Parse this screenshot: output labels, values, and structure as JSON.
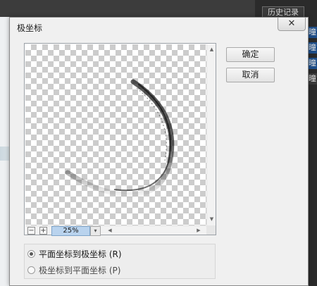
{
  "background": {
    "history_panel_tab": "历史记录",
    "panel_strip_chars": [
      "曈",
      "曈",
      "曈",
      "曈"
    ]
  },
  "dialog": {
    "title": "极坐标",
    "close_symbol": "✕",
    "buttons": {
      "ok": "确定",
      "cancel": "取消"
    },
    "zoom": {
      "minus": "−",
      "plus": "+",
      "value": "25%",
      "dropdown_symbol": "▾"
    },
    "scroll_arrows": {
      "up": "▲",
      "down": "▼",
      "left": "◀",
      "right": "▶"
    },
    "options": [
      {
        "label": "平面坐标到极坐标 (R)",
        "selected": true
      },
      {
        "label": "极坐标到平面坐标 (P)",
        "selected": false
      }
    ]
  },
  "colors": {
    "zoom_field_bg": "#b9d3ee",
    "checker": "#cccccc",
    "dark_bg": "#2b2b2b"
  }
}
